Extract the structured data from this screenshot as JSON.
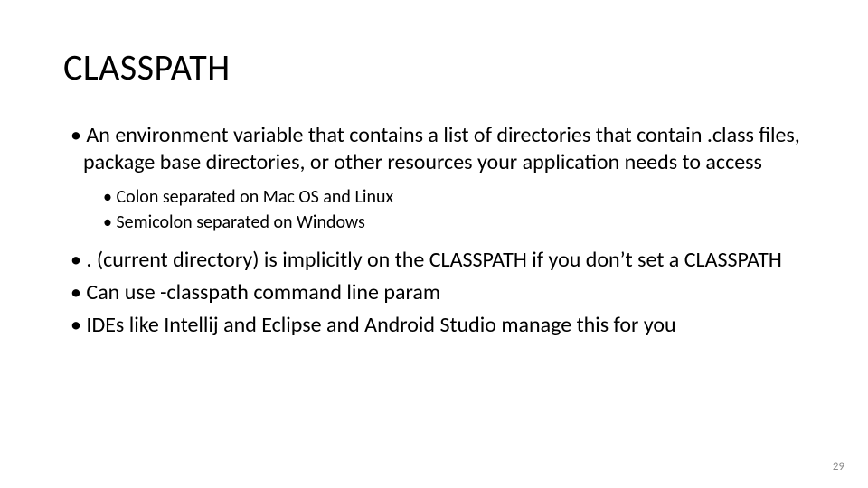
{
  "title": "CLASSPATH",
  "bullets": {
    "b1": "An environment variable that contains a list of directories that contain .class files, package base directories, or other resources your application needs to access",
    "b1_sub1": "Colon separated on Mac OS and Linux",
    "b1_sub2": "Semicolon separated on Windows",
    "b2": ". (current directory) is implicitly on the CLASSPATH if you don’t set a CLASSPATH",
    "b3": "Can use -classpath command line param",
    "b4": "IDEs like Intellij and Eclipse and Android Studio manage this for you"
  },
  "page_number": "29"
}
